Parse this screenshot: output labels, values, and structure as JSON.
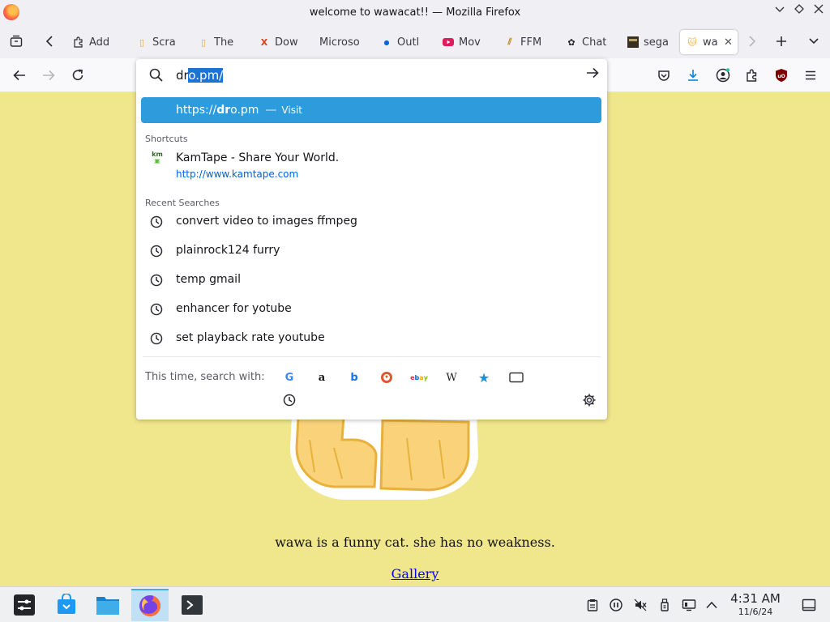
{
  "window": {
    "title": "welcome to wawacat!! — Mozilla Firefox",
    "controls": [
      "minimize-icon",
      "maximize-icon",
      "close-icon"
    ]
  },
  "tabs": {
    "items": [
      {
        "label": "Add",
        "favicon": "puzzle-icon",
        "color": "#2b2a33"
      },
      {
        "label": "Scra",
        "favicon": "coin-icon",
        "color": "#e8a33a"
      },
      {
        "label": "The",
        "favicon": "coin-icon",
        "color": "#e8a33a"
      },
      {
        "label": "Dow",
        "favicon": "x-logo-icon",
        "color": "#e03b1b"
      },
      {
        "label": "Microso",
        "favicon": "blank-icon",
        "color": "#ffffff"
      },
      {
        "label": "Outl",
        "favicon": "dot-icon",
        "color": "#0a66d8"
      },
      {
        "label": "Mov",
        "favicon": "youtube-icon",
        "color": "#e01b5a"
      },
      {
        "label": "FFM",
        "favicon": "ffmpeg-icon",
        "color": "#c67a1a"
      },
      {
        "label": "Chat",
        "favicon": "openai-icon",
        "color": "#222222"
      },
      {
        "label": "sega",
        "favicon": "sega-icon",
        "color": "#3a3020"
      },
      {
        "label": "wa",
        "favicon": "cat-icon",
        "color": "#f3b54a",
        "active": true
      }
    ]
  },
  "url": {
    "typed": "dr",
    "autofill_selected": "o.pm/",
    "visit_result": {
      "prefix": "https://",
      "bold": "dr",
      "rest": "o.pm",
      "separator": "—",
      "action": "Visit"
    }
  },
  "shortcuts": {
    "label": "Shortcuts",
    "items": [
      {
        "title": "KamTape - Share Your World.",
        "url": "http://www.kamtape.com",
        "icon_text": "km"
      }
    ]
  },
  "recent": {
    "label": "Recent Searches",
    "items": [
      "convert video to images ffmpeg",
      "plainrock124 furry",
      "temp gmail",
      "enhancer for yotube",
      "set playback rate youtube"
    ]
  },
  "search_with": {
    "label": "This time, search with:",
    "engines": [
      {
        "name": "google-icon",
        "glyph": "G",
        "color": "#4285f4"
      },
      {
        "name": "amazon-icon",
        "glyph": "a",
        "color": "#111111"
      },
      {
        "name": "bing-icon",
        "glyph": "b",
        "color": "#1a73e8"
      },
      {
        "name": "duckduckgo-icon",
        "glyph": "●",
        "color": "#de5833"
      },
      {
        "name": "ebay-icon",
        "glyph": "ebay",
        "color": "#e53238"
      },
      {
        "name": "wikipedia-icon",
        "glyph": "W",
        "color": "#222222"
      },
      {
        "name": "bookmarks-star-icon",
        "glyph": "★",
        "color": "#1e90d6"
      },
      {
        "name": "tabs-icon",
        "glyph": "▭",
        "color": "#333333"
      }
    ]
  },
  "page": {
    "caption": "wawa is a funny cat. she has no weakness.",
    "gallery_link": "Gallery"
  },
  "taskbar": {
    "time": "4:31 AM",
    "date": "11/6/24"
  }
}
